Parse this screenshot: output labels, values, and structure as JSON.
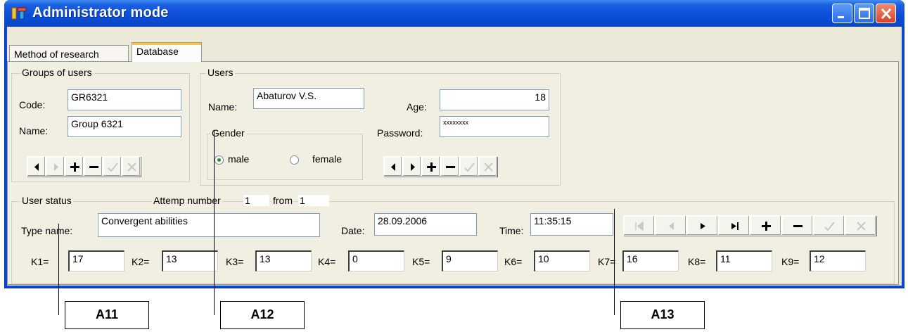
{
  "window": {
    "title": "Administrator mode",
    "icons": {
      "app": "app-icon",
      "minimize": "minimize-icon",
      "maximize": "maximize-icon",
      "close": "close-icon"
    }
  },
  "tabs": [
    {
      "label": "Method of research",
      "active": false
    },
    {
      "label": "Database",
      "active": true
    }
  ],
  "groups_of_users": {
    "legend": "Groups of users",
    "code_label": "Code:",
    "code_value": "GR6321",
    "name_label": "Name:",
    "name_value": "Group 6321",
    "navigator": [
      "prior-icon",
      "next-icon",
      "insert-icon",
      "delete-icon",
      "post-icon",
      "cancel-icon"
    ]
  },
  "users": {
    "legend": "Users",
    "name_label": "Name:",
    "name_value": "Abaturov V.S.",
    "age_label": "Age:",
    "age_value": "18",
    "password_label": "Password:",
    "password_value": "xxxxxxxx",
    "gender": {
      "legend": "Gender",
      "options": [
        "male",
        "female"
      ],
      "selected": "male"
    },
    "navigator": [
      "prior-icon",
      "next-icon",
      "insert-icon",
      "delete-icon",
      "post-icon",
      "cancel-icon"
    ]
  },
  "user_status": {
    "legend": "User status",
    "attempt_label": "Attemp number",
    "attempt_value": "1",
    "from_label": "from",
    "from_value": "1",
    "type_name_label": "Type name:",
    "type_name_value": "Convergent abilities",
    "date_label": "Date:",
    "date_value": "28.09.2006",
    "time_label": "Time:",
    "time_value": "11:35:15",
    "coefficients": [
      {
        "label": "K1=",
        "value": "17"
      },
      {
        "label": "K2=",
        "value": "13"
      },
      {
        "label": "K3=",
        "value": "13"
      },
      {
        "label": "K4=",
        "value": "0"
      },
      {
        "label": "K5=",
        "value": "9"
      },
      {
        "label": "K6=",
        "value": "10"
      },
      {
        "label": "K7=",
        "value": "16"
      },
      {
        "label": "K8=",
        "value": "11"
      },
      {
        "label": "K9=",
        "value": "12"
      }
    ],
    "navigator": [
      "first-icon",
      "prior-icon",
      "next-icon",
      "last-icon",
      "insert-icon",
      "delete-icon",
      "post-icon",
      "cancel-icon"
    ]
  },
  "callouts": [
    "A11",
    "A12",
    "A13"
  ],
  "colors": {
    "titlebar": "#0b4fd8",
    "form": "#ece9d8",
    "close_button": "#d6432a"
  }
}
